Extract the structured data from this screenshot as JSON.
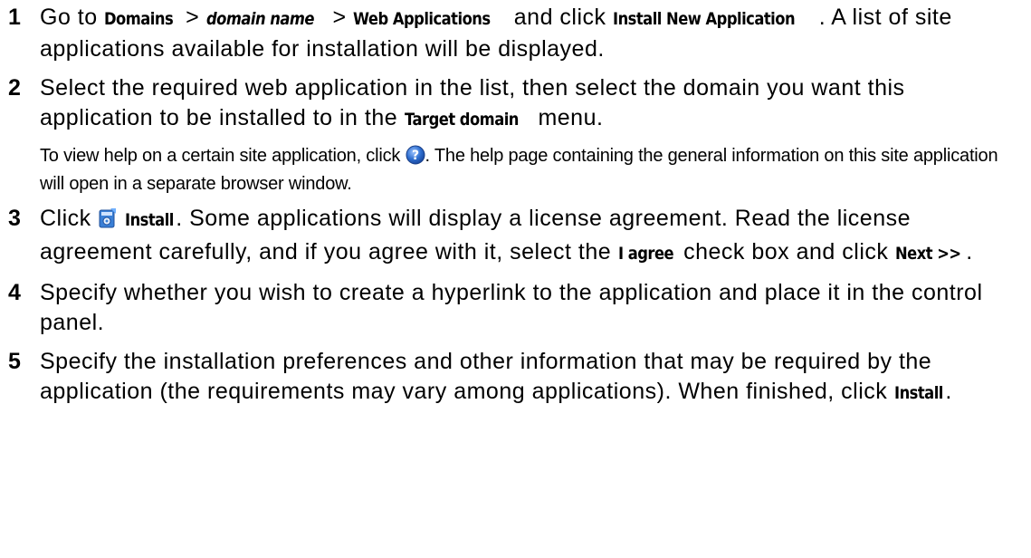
{
  "steps": [
    {
      "num": "1",
      "t1": "Go to ",
      "b1": "Domains",
      "t2": " > ",
      "b2": "domain name",
      "t3": " > ",
      "b3": "Web Applications",
      "t4": " and click ",
      "b4": "Install New Application",
      "t5": ". A list of site applications available for installation will be displayed."
    },
    {
      "num": "2",
      "t1": "Select the required web application in the list, then select the domain you want this application to be installed to in the ",
      "b1": "Target domain",
      "t2": " menu."
    },
    {
      "num": "3",
      "t1": "Click ",
      "b1": "Install",
      "t2": ". Some applications will display a license agreement. Read the license agreement carefully, and if you agree with it, select the ",
      "b2": "I agree",
      "t3": " check box and click ",
      "b3": "Next >>",
      "t4": "."
    },
    {
      "num": "4",
      "t1": "Specify whether you wish to create a hyperlink to the application and place it in the control panel."
    },
    {
      "num": "5",
      "t1": "Specify the installation preferences and other information that may be required by the application (the requirements may vary among applications). When finished, click ",
      "b1": "Install",
      "t2": "."
    }
  ],
  "note": {
    "t1": "To view help on a certain site application, click ",
    "t2": ". The help page containing the general information on this site application will open in a separate browser window."
  },
  "icons": {
    "help": "help-question-icon",
    "install": "install-application-icon",
    "help_color": "#2f6fd0",
    "install_color": "#3a7fd6"
  }
}
